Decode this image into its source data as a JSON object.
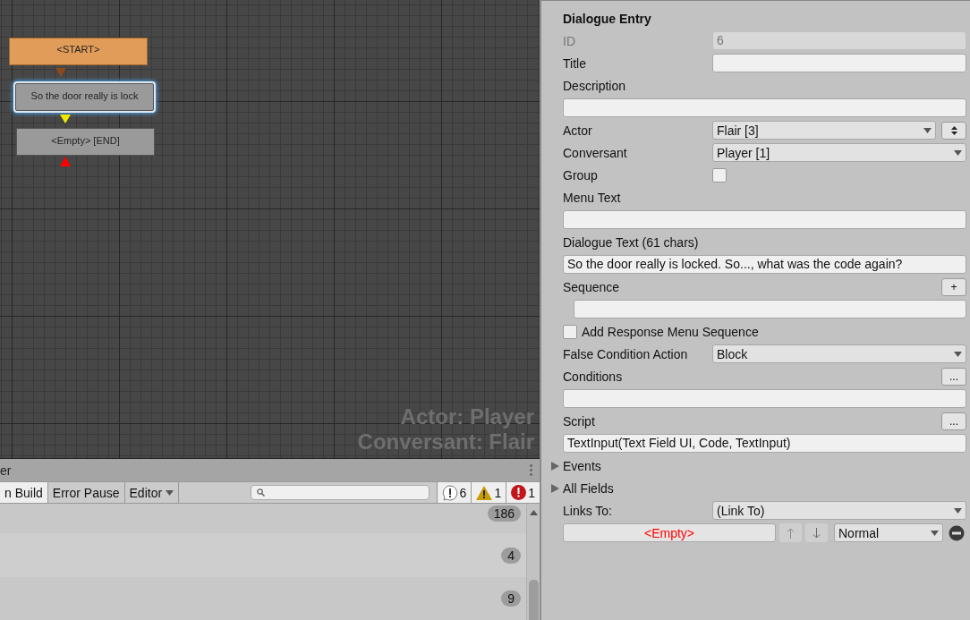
{
  "canvas": {
    "nodes": [
      {
        "label": "<START>",
        "kind": "start",
        "selected": false
      },
      {
        "label": "So the door really is lock",
        "kind": "entry",
        "selected": true
      },
      {
        "label": "<Empty> [END]",
        "kind": "end",
        "selected": false
      }
    ],
    "overlay": [
      "Actor: Player",
      "Conversant: Flair"
    ]
  },
  "console": {
    "tab": "er",
    "toolbar": [
      {
        "label": "n Build",
        "on": true,
        "kind": "toggle"
      },
      {
        "label": "Error Pause",
        "on": false,
        "kind": "toggle"
      },
      {
        "label": "Editor",
        "on": false,
        "kind": "menu"
      }
    ],
    "counts": [
      {
        "kind": "info",
        "count": "6",
        "on": true
      },
      {
        "kind": "warning",
        "count": "1",
        "on": true
      },
      {
        "kind": "error",
        "count": "1",
        "on": true
      }
    ],
    "rows": [
      {
        "badge": "186"
      },
      {
        "badge": "4"
      },
      {
        "badge": "9"
      }
    ]
  },
  "inspector": {
    "title": "Dialogue Entry",
    "rows": [
      {
        "kind": "field",
        "label": "ID",
        "value": "6",
        "disabled": true
      },
      {
        "kind": "field",
        "label": "Title",
        "disabled": false
      },
      {
        "kind": "block",
        "label": "Description"
      },
      {
        "kind": "dropdown",
        "label": "Actor",
        "value": "Flair [3]",
        "stepper": true
      },
      {
        "kind": "dropdown",
        "label": "Conversant",
        "value": "Player [1]"
      },
      {
        "kind": "checkbox",
        "label": "Group",
        "checked": false
      },
      {
        "kind": "block",
        "label": "Menu Text"
      },
      {
        "kind": "block",
        "label": "Dialogue Text (61 chars)",
        "value": "So the door really is locked. So..., what was the code again?"
      },
      {
        "kind": "block",
        "label": "Sequence",
        "button": "+",
        "indent": true
      },
      {
        "kind": "toggle",
        "label": "Add Response Menu Sequence",
        "checked": false
      },
      {
        "kind": "dropdown",
        "label": "False Condition Action",
        "value": "Block"
      },
      {
        "kind": "block",
        "label": "Conditions",
        "button": "..."
      },
      {
        "kind": "block",
        "label": "Script",
        "button": "...",
        "value": "TextInput(Text Field UI, Code, TextInput)"
      },
      {
        "kind": "foldout",
        "label": "Events",
        "expanded": false
      },
      {
        "kind": "foldout",
        "label": "All Fields",
        "expanded": false
      },
      {
        "kind": "dropdown",
        "label": "Links To:",
        "value": "(Link To)"
      },
      {
        "kind": "link",
        "target": "<Empty>",
        "priority": "Normal"
      }
    ]
  }
}
